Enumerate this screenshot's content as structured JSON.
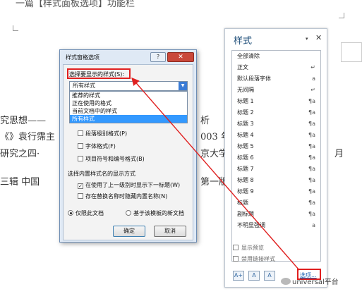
{
  "document": {
    "top_line": "一篇【样式面板选项】功能栏",
    "lines": [
      {
        "text": "究思想——",
        "suffix": "析"
      },
      {
        "text": "《》袁行霈主",
        "suffix": "003 年"
      },
      {
        "text": "研究之四·",
        "suffix": "京大学"
      },
      {
        "text": "三辑  中国",
        "suffix": "第一版"
      }
    ],
    "right_char": "月"
  },
  "styles_pane": {
    "title": "样式",
    "dropdown_glyph": "▾",
    "close_glyph": "✕",
    "items": [
      {
        "label": "全部清除",
        "icon": ""
      },
      {
        "label": "正文",
        "icon": "↵"
      },
      {
        "label": "默认段落字体",
        "icon": "a"
      },
      {
        "label": "无间隔",
        "icon": "↵"
      },
      {
        "label": "标题 1",
        "icon": "¶a"
      },
      {
        "label": "标题 2",
        "icon": "¶a"
      },
      {
        "label": "标题 3",
        "icon": "¶a"
      },
      {
        "label": "标题 4",
        "icon": "¶a"
      },
      {
        "label": "标题 5",
        "icon": "¶a"
      },
      {
        "label": "标题 6",
        "icon": "¶a"
      },
      {
        "label": "标题 7",
        "icon": "¶a"
      },
      {
        "label": "标题 8",
        "icon": "¶a"
      },
      {
        "label": "标题 9",
        "icon": "¶a"
      },
      {
        "label": "标题",
        "icon": "¶a"
      },
      {
        "label": "副标题",
        "icon": "¶a"
      },
      {
        "label": "不明显强调",
        "icon": "a"
      }
    ],
    "show_preview": "显示预览",
    "disable_linked": "禁用链接样式",
    "buttons": [
      "A+",
      "A",
      "A"
    ],
    "options_link": "选项..."
  },
  "dialog": {
    "title": "样式窗格选项",
    "help": "?",
    "close": "✕",
    "select_label": "选择要显示的样式(S):",
    "select_value": "所有样式",
    "dropdown_options": [
      "推荐的样式",
      "正在使用的格式",
      "当前文档中的样式",
      "所有样式"
    ],
    "checkboxes": [
      {
        "label": "段落级别格式(P)",
        "checked": false
      },
      {
        "label": "字体格式(F)",
        "checked": false
      },
      {
        "label": "项目符号和编号格式(B)",
        "checked": false
      }
    ],
    "builtin_label": "选择内置样式名的显示方式",
    "builtin_checks": [
      {
        "label": "在使用了上一级别时显示下一标题(W)",
        "checked": true
      },
      {
        "label": "存在替换名称时隐藏内置名称(N)",
        "checked": false
      }
    ],
    "radios": [
      {
        "label": "仅限此文档",
        "on": true
      },
      {
        "label": "基于该模板的新文档",
        "on": false
      }
    ],
    "ok": "确定",
    "cancel": "取消"
  },
  "watermark": "universal平台",
  "accent_color": "#e02020"
}
